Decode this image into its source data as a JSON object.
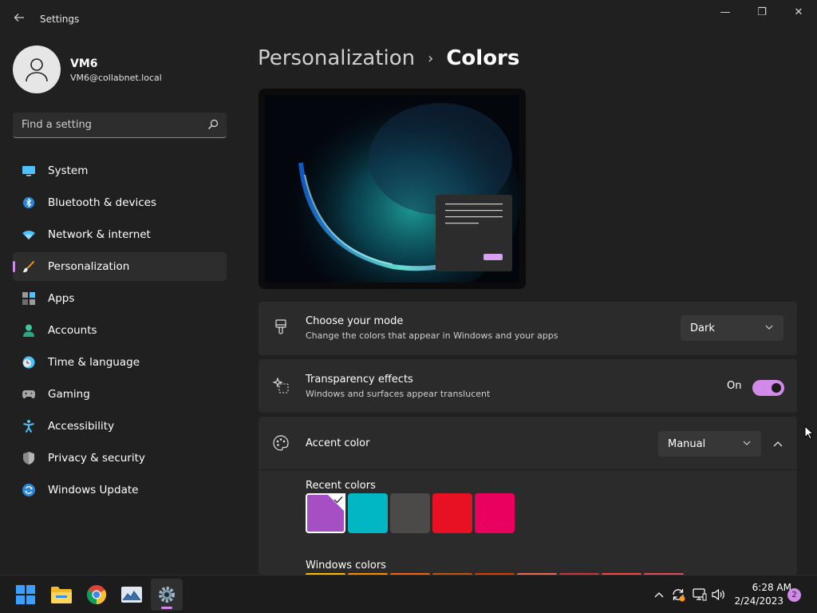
{
  "window": {
    "title": "Settings",
    "back_icon": "back-arrow-icon",
    "minimize_glyph": "—",
    "maximize_glyph": "❐",
    "close_glyph": "✕"
  },
  "profile": {
    "name": "VM6",
    "email": "VM6@collabnet.local"
  },
  "search": {
    "placeholder": "Find a setting"
  },
  "nav": {
    "items": [
      {
        "label": "System",
        "icon": "system-icon"
      },
      {
        "label": "Bluetooth & devices",
        "icon": "bluetooth-icon"
      },
      {
        "label": "Network & internet",
        "icon": "wifi-icon"
      },
      {
        "label": "Personalization",
        "icon": "brush-icon",
        "selected": true
      },
      {
        "label": "Apps",
        "icon": "apps-icon"
      },
      {
        "label": "Accounts",
        "icon": "accounts-icon"
      },
      {
        "label": "Time & language",
        "icon": "clock-globe-icon"
      },
      {
        "label": "Gaming",
        "icon": "gamepad-icon"
      },
      {
        "label": "Accessibility",
        "icon": "accessibility-icon"
      },
      {
        "label": "Privacy & security",
        "icon": "shield-icon"
      },
      {
        "label": "Windows Update",
        "icon": "update-icon"
      }
    ]
  },
  "breadcrumb": {
    "parent": "Personalization",
    "separator": "›",
    "current": "Colors"
  },
  "mode": {
    "title": "Choose your mode",
    "description": "Change the colors that appear in Windows and your apps",
    "value": "Dark"
  },
  "transparency": {
    "title": "Transparency effects",
    "description": "Windows and surfaces appear translucent",
    "state_label": "On",
    "on": true
  },
  "accent": {
    "title": "Accent color",
    "value": "Manual",
    "expanded": true
  },
  "recent_colors": {
    "label": "Recent colors",
    "colors": [
      "#a64fc4",
      "#00b7c3",
      "#4c4a48",
      "#e81123",
      "#ea005e"
    ],
    "selected_index": 0
  },
  "windows_colors": {
    "label": "Windows colors",
    "colors": [
      "#ffb900",
      "#ff8c00",
      "#f7630c",
      "#ca5010",
      "#da3b01",
      "#ef6950",
      "#d13438",
      "#ff4343",
      "#e74856"
    ]
  },
  "taskbar": {
    "apps": [
      "start-icon",
      "file-explorer-icon",
      "chrome-icon",
      "photos-icon",
      "settings-app-icon"
    ],
    "active_app": "settings-app-icon",
    "tray": [
      "chevron-up-icon",
      "sync-icon",
      "network-icon",
      "volume-icon"
    ],
    "time": "6:28 AM",
    "date": "2/24/2023",
    "notifications": "2"
  },
  "colors": {
    "accent": "#d28ae8",
    "background": "#202020",
    "card": "#2b2b2b"
  }
}
